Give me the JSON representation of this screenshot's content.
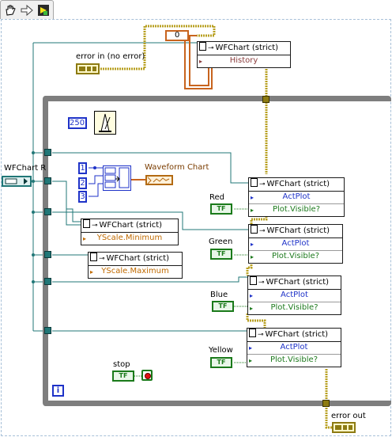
{
  "toolbar": {
    "icons": [
      "hand-tool-icon",
      "run-arrow-icon",
      "highlight-execution-icon"
    ]
  },
  "chart_ref": {
    "label": "WFChart R"
  },
  "error_in": {
    "label": "error in (no error)"
  },
  "error_out": {
    "label": "error out"
  },
  "history_const": {
    "value": "0"
  },
  "wait_const": {
    "value": "250"
  },
  "array_consts": [
    "1",
    "2",
    "3"
  ],
  "waveform_chart": {
    "label": "Waveform Chart"
  },
  "stop": {
    "label": "stop"
  },
  "loop": {
    "iteration_label": "i"
  },
  "property_nodes": {
    "history": {
      "title": "WFChart (strict)",
      "rows": [
        "History"
      ]
    },
    "red": {
      "title": "WFChart (strict)",
      "rows": [
        "ActPlot",
        "Plot.Visible?"
      ],
      "label": "Red"
    },
    "green": {
      "title": "WFChart (strict)",
      "rows": [
        "ActPlot",
        "Plot.Visible?"
      ],
      "label": "Green"
    },
    "blue": {
      "title": "WFChart (strict)",
      "rows": [
        "ActPlot",
        "Plot.Visible?"
      ],
      "label": "Blue"
    },
    "yellow": {
      "title": "WFChart (strict)",
      "rows": [
        "ActPlot",
        "Plot.Visible?"
      ],
      "label": "Yellow"
    },
    "ymin": {
      "title": "WFChart (strict)",
      "rows": [
        "YScale.Minimum"
      ]
    },
    "ymax": {
      "title": "WFChart (strict)",
      "rows": [
        "YScale.Maximum"
      ]
    }
  },
  "bool_text": "TF",
  "colors": {
    "ref_wire": "#217777",
    "error_wire": "#b8a022",
    "numeric_wire": "#1e32c8",
    "boolean_wire": "#1a7a1a",
    "loop_border": "#7e7e7e"
  }
}
